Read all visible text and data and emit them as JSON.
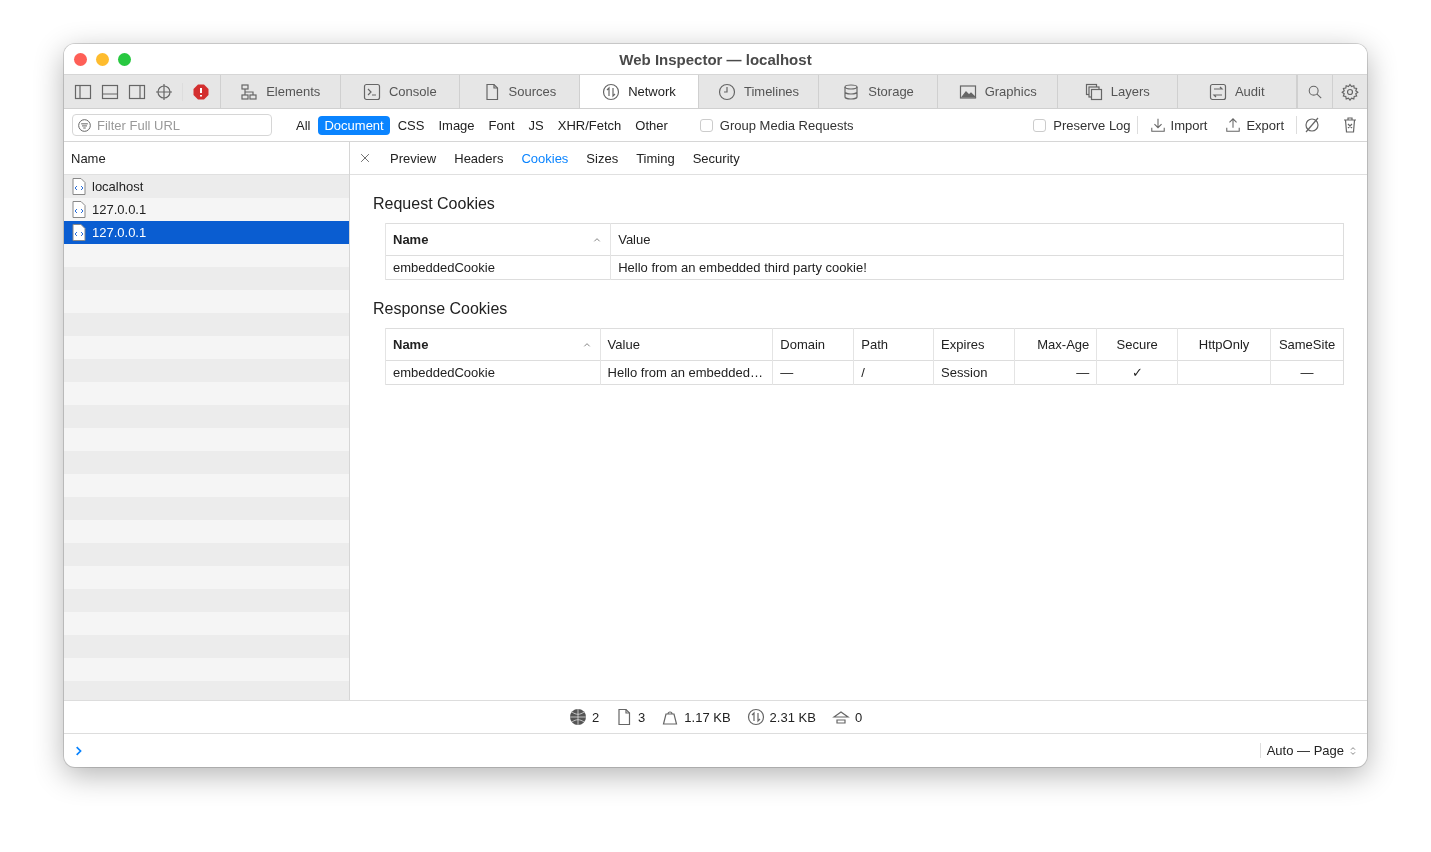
{
  "window": {
    "title": "Web Inspector — localhost"
  },
  "tabs": [
    {
      "label": "Elements",
      "selected": false
    },
    {
      "label": "Console",
      "selected": false
    },
    {
      "label": "Sources",
      "selected": false
    },
    {
      "label": "Network",
      "selected": true
    },
    {
      "label": "Timelines",
      "selected": false
    },
    {
      "label": "Storage",
      "selected": false
    },
    {
      "label": "Graphics",
      "selected": false
    },
    {
      "label": "Layers",
      "selected": false
    },
    {
      "label": "Audit",
      "selected": false
    }
  ],
  "filter_bar": {
    "placeholder": "Filter Full URL",
    "types": [
      {
        "label": "All",
        "selected": false
      },
      {
        "label": "Document",
        "selected": true
      },
      {
        "label": "CSS",
        "selected": false
      },
      {
        "label": "Image",
        "selected": false
      },
      {
        "label": "Font",
        "selected": false
      },
      {
        "label": "JS",
        "selected": false
      },
      {
        "label": "XHR/Fetch",
        "selected": false
      },
      {
        "label": "Other",
        "selected": false
      }
    ],
    "group_media": {
      "label": "Group Media Requests",
      "checked": false
    },
    "preserve_log": {
      "label": "Preserve Log",
      "checked": false
    },
    "import": "Import",
    "export": "Export"
  },
  "requests": {
    "header": "Name",
    "items": [
      {
        "name": "localhost",
        "selected": false
      },
      {
        "name": "127.0.0.1",
        "selected": false
      },
      {
        "name": "127.0.0.1",
        "selected": true
      }
    ]
  },
  "detail_tabs": [
    {
      "label": "Preview",
      "selected": false
    },
    {
      "label": "Headers",
      "selected": false
    },
    {
      "label": "Cookies",
      "selected": true
    },
    {
      "label": "Sizes",
      "selected": false
    },
    {
      "label": "Timing",
      "selected": false
    },
    {
      "label": "Security",
      "selected": false
    }
  ],
  "request_cookies": {
    "title": "Request Cookies",
    "columns": [
      {
        "label": "Name",
        "sorted": true
      },
      {
        "label": "Value",
        "sorted": false
      }
    ],
    "rows": [
      [
        "embeddedCookie",
        "Hello from an embedded third party cookie!"
      ]
    ]
  },
  "response_cookies": {
    "title": "Response Cookies",
    "columns": [
      {
        "label": "Name",
        "sorted": true
      },
      {
        "label": "Value",
        "sorted": false
      },
      {
        "label": "Domain",
        "sorted": false
      },
      {
        "label": "Path",
        "sorted": false
      },
      {
        "label": "Expires",
        "sorted": false
      },
      {
        "label": "Max-Age",
        "sorted": false
      },
      {
        "label": "Secure",
        "sorted": false
      },
      {
        "label": "HttpOnly",
        "sorted": false
      },
      {
        "label": "SameSite",
        "sorted": false
      }
    ],
    "rows": [
      [
        "embeddedCookie",
        "Hello from an embedded…",
        "—",
        "/",
        "Session",
        "—",
        "✓",
        "",
        "—"
      ]
    ]
  },
  "status_bar": [
    "2",
    "3",
    "1.17 KB",
    "2.31 KB",
    "0"
  ],
  "console": {
    "mode": "Auto — Page"
  }
}
